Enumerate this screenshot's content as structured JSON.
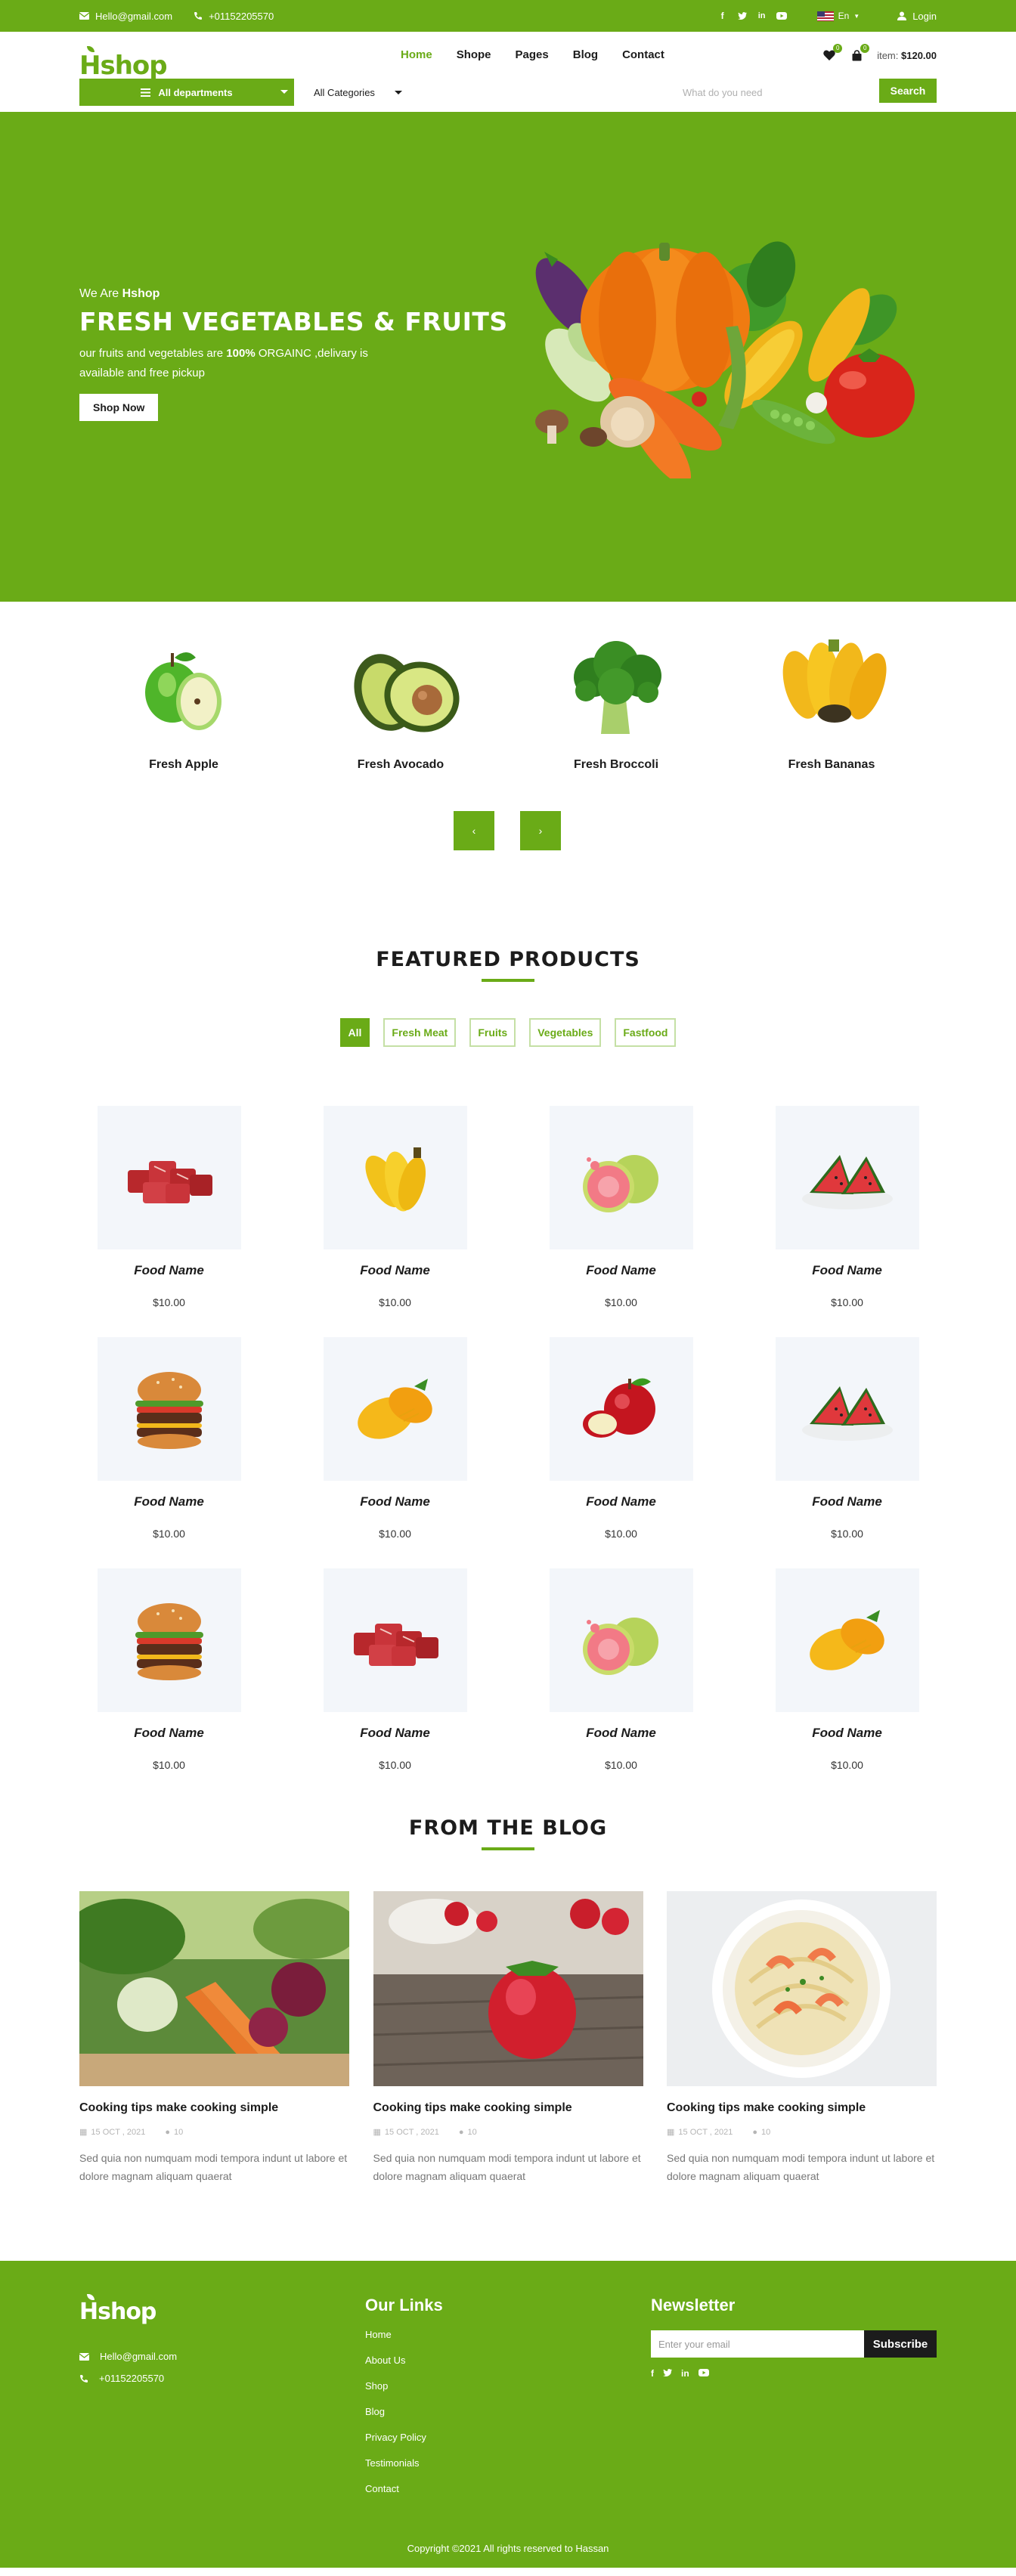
{
  "topbar": {
    "email": "Hello@gmail.com",
    "phone": "+01152205570",
    "language": "En",
    "login": "Login",
    "socials": [
      "facebook-icon",
      "twitter-icon",
      "linkedin-icon",
      "youtube-icon"
    ]
  },
  "header": {
    "logo": "Hshop",
    "nav": [
      "Home",
      "Shope",
      "Pages",
      "Blog",
      "Contact"
    ],
    "active_nav": "Home",
    "wishlist_count": "0",
    "cart_count": "0",
    "item_label": "item:",
    "item_total": "$120.00"
  },
  "search": {
    "departments": "All departments",
    "categories": "All Categories",
    "placeholder": "What do you need",
    "button": "Search"
  },
  "hero": {
    "welcome_prefix": "We Are",
    "welcome_brand": "Hshop",
    "title": "FRESH VEGETABLES & FRUITS",
    "desc_before": "our fruits and vegetables are",
    "desc_bold": "100%",
    "desc_after": "ORGAINC ,delivary is available and free pickup",
    "cta": "Shop Now"
  },
  "categories": {
    "items": [
      "Fresh Apple",
      "Fresh Avocado",
      "Fresh Broccoli",
      "Fresh Bananas"
    ],
    "prev": "‹",
    "next": "›"
  },
  "featured": {
    "title": "FEATURED PRODUCTS",
    "filters": [
      "All",
      "Fresh Meat",
      "Fruits",
      "Vegetables",
      "Fastfood"
    ],
    "products": [
      {
        "name": "Food Name",
        "price": "$10.00",
        "image": "meat"
      },
      {
        "name": "Food Name",
        "price": "$10.00",
        "image": "banana"
      },
      {
        "name": "Food Name",
        "price": "$10.00",
        "image": "guava"
      },
      {
        "name": "Food Name",
        "price": "$10.00",
        "image": "watermelon"
      },
      {
        "name": "Food Name",
        "price": "$10.00",
        "image": "burger"
      },
      {
        "name": "Food Name",
        "price": "$10.00",
        "image": "mango"
      },
      {
        "name": "Food Name",
        "price": "$10.00",
        "image": "apple"
      },
      {
        "name": "Food Name",
        "price": "$10.00",
        "image": "watermelon"
      },
      {
        "name": "Food Name",
        "price": "$10.00",
        "image": "burger"
      },
      {
        "name": "Food Name",
        "price": "$10.00",
        "image": "meat"
      },
      {
        "name": "Food Name",
        "price": "$10.00",
        "image": "guava"
      },
      {
        "name": "Food Name",
        "price": "$10.00",
        "image": "mango"
      }
    ]
  },
  "blog": {
    "title": "FROM THE BLOG",
    "posts": [
      {
        "title": "Cooking tips make cooking simple",
        "date": "15 OCT , 2021",
        "comments": "10",
        "excerpt": "Sed quia non numquam modi tempora indunt ut labore et dolore magnam aliquam quaerat",
        "image": "vegetables"
      },
      {
        "title": "Cooking tips make cooking simple",
        "date": "15 OCT , 2021",
        "comments": "10",
        "excerpt": "Sed quia non numquam modi tempora indunt ut labore et dolore magnam aliquam quaerat",
        "image": "strawberries"
      },
      {
        "title": "Cooking tips make cooking simple",
        "date": "15 OCT , 2021",
        "comments": "10",
        "excerpt": "Sed quia non numquam modi tempora indunt ut labore et dolore magnam aliquam quaerat",
        "image": "pasta"
      }
    ]
  },
  "footer": {
    "logo": "Hshop",
    "email": "Hello@gmail.com",
    "phone": "+01152205570",
    "links_title": "Our Links",
    "links": [
      "Home",
      "About Us",
      "Shop",
      "Blog",
      "Privacy Policy",
      "Testimonials",
      "Contact"
    ],
    "newsletter_title": "Newsletter",
    "newsletter_placeholder": "Enter your email",
    "newsletter_button": "Subscribe",
    "copyright": "Copyright ©2021 All rights reserved to Hassan"
  },
  "colors": {
    "brand": "#6aab17",
    "dark": "#1c1c1c",
    "product_bg": "#f3f6fa"
  }
}
